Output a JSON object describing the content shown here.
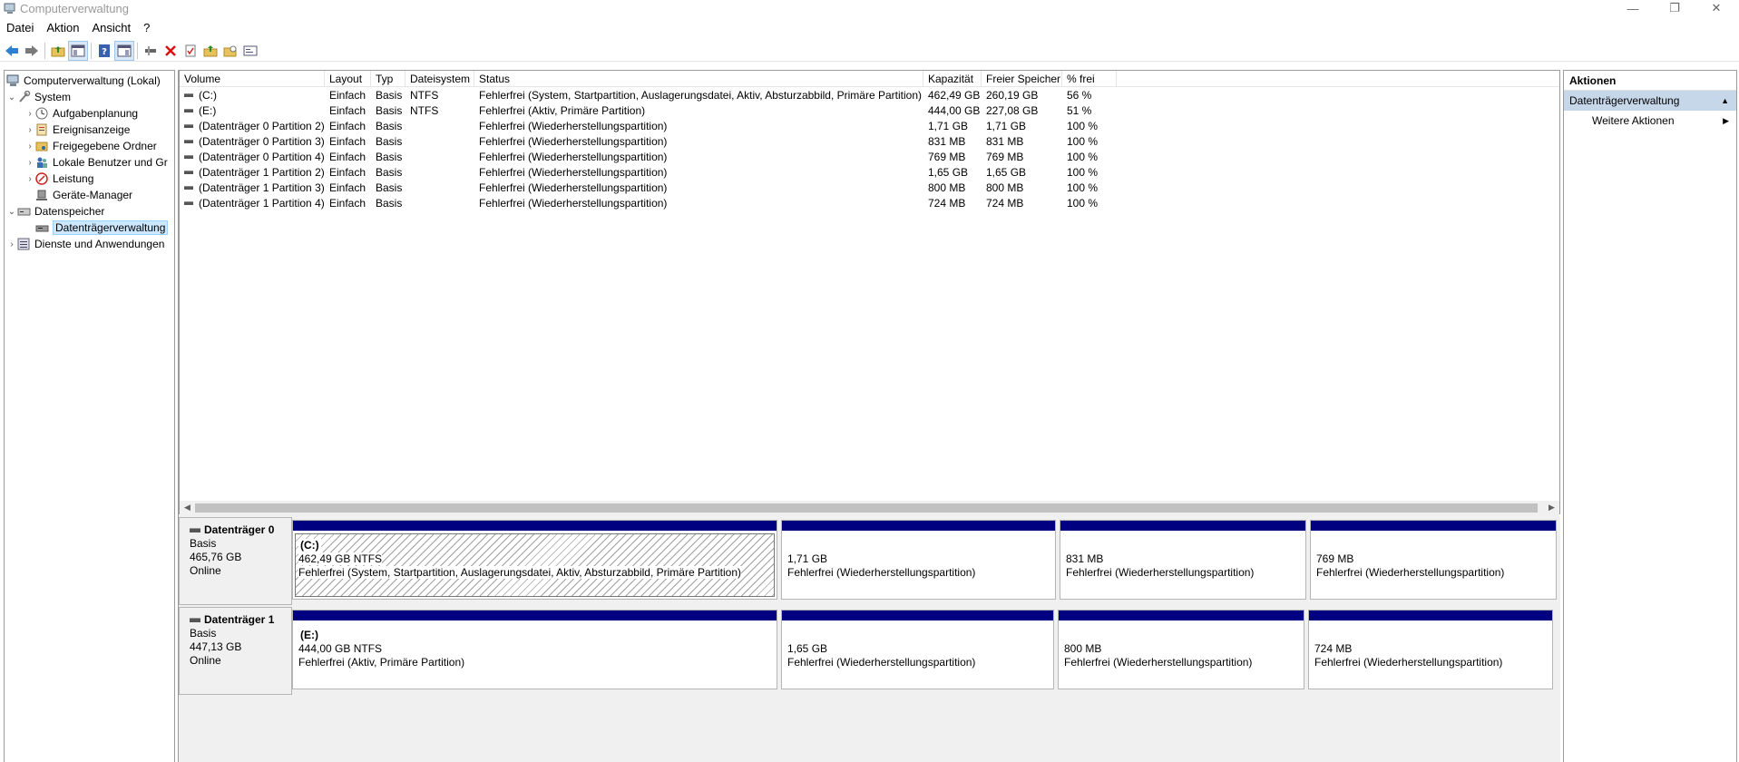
{
  "window": {
    "title": "Computerverwaltung",
    "minimize_glyph": "—",
    "maximize_glyph": "❐",
    "close_glyph": "✕"
  },
  "menu": [
    "Datei",
    "Aktion",
    "Ansicht",
    "?"
  ],
  "toolbar": {
    "icons": [
      "back-icon",
      "forward-icon",
      "up-folder-icon",
      "show-hide-tree-icon",
      "help-icon",
      "properties-view-icon",
      "connect-icon",
      "delete-icon",
      "check-icon",
      "export-icon",
      "open-folder-icon",
      "console-icon"
    ]
  },
  "tree": {
    "root": "Computerverwaltung (Lokal)",
    "system": "System",
    "aufgabenplanung": "Aufgabenplanung",
    "ereignisanzeige": "Ereignisanzeige",
    "freigegebene_ordner": "Freigegebene Ordner",
    "lokale_benutzer": "Lokale Benutzer und Gr",
    "leistung": "Leistung",
    "geraete_manager": "Geräte-Manager",
    "datenspeicher": "Datenspeicher",
    "datentraegerverwaltung": "Datenträgerverwaltung",
    "dienste": "Dienste und Anwendungen"
  },
  "volume_list": {
    "columns": [
      "Volume",
      "Layout",
      "Typ",
      "Dateisystem",
      "Status",
      "Kapazität",
      "Freier Speicher",
      "% frei"
    ],
    "rows": [
      [
        "(C:)",
        "Einfach",
        "Basis",
        "NTFS",
        "Fehlerfrei (System, Startpartition, Auslagerungsdatei, Aktiv, Absturzabbild, Primäre Partition)",
        "462,49 GB",
        "260,19 GB",
        "56 %"
      ],
      [
        "(E:)",
        "Einfach",
        "Basis",
        "NTFS",
        "Fehlerfrei (Aktiv, Primäre Partition)",
        "444,00 GB",
        "227,08 GB",
        "51 %"
      ],
      [
        "(Datenträger 0 Partition 2)",
        "Einfach",
        "Basis",
        "",
        "Fehlerfrei (Wiederherstellungspartition)",
        "1,71 GB",
        "1,71 GB",
        "100 %"
      ],
      [
        "(Datenträger 0 Partition 3)",
        "Einfach",
        "Basis",
        "",
        "Fehlerfrei (Wiederherstellungspartition)",
        "831 MB",
        "831 MB",
        "100 %"
      ],
      [
        "(Datenträger 0 Partition 4)",
        "Einfach",
        "Basis",
        "",
        "Fehlerfrei (Wiederherstellungspartition)",
        "769 MB",
        "769 MB",
        "100 %"
      ],
      [
        "(Datenträger 1 Partition 2)",
        "Einfach",
        "Basis",
        "",
        "Fehlerfrei (Wiederherstellungspartition)",
        "1,65 GB",
        "1,65 GB",
        "100 %"
      ],
      [
        "(Datenträger 1 Partition 3)",
        "Einfach",
        "Basis",
        "",
        "Fehlerfrei (Wiederherstellungspartition)",
        "800 MB",
        "800 MB",
        "100 %"
      ],
      [
        "(Datenträger 1 Partition 4)",
        "Einfach",
        "Basis",
        "",
        "Fehlerfrei (Wiederherstellungspartition)",
        "724 MB",
        "724 MB",
        "100 %"
      ]
    ]
  },
  "disks": [
    {
      "name": "Datenträger 0",
      "type": "Basis",
      "size": "465,76 GB",
      "state": "Online",
      "partitions": [
        {
          "label": "(C:)",
          "size": "462,49 GB NTFS",
          "status": "Fehlerfrei (System, Startpartition, Auslagerungsdatei, Aktiv, Absturzabbild, Primäre Partition)"
        },
        {
          "label": "",
          "size": "1,71 GB",
          "status": "Fehlerfrei (Wiederherstellungspartition)"
        },
        {
          "label": "",
          "size": "831 MB",
          "status": "Fehlerfrei (Wiederherstellungspartition)"
        },
        {
          "label": "",
          "size": "769 MB",
          "status": "Fehlerfrei (Wiederherstellungspartition)"
        }
      ]
    },
    {
      "name": "Datenträger 1",
      "type": "Basis",
      "size": "447,13 GB",
      "state": "Online",
      "partitions": [
        {
          "label": "(E:)",
          "size": "444,00 GB NTFS",
          "status": "Fehlerfrei (Aktiv, Primäre Partition)"
        },
        {
          "label": "",
          "size": "1,65 GB",
          "status": "Fehlerfrei (Wiederherstellungspartition)"
        },
        {
          "label": "",
          "size": "800 MB",
          "status": "Fehlerfrei (Wiederherstellungspartition)"
        },
        {
          "label": "",
          "size": "724 MB",
          "status": "Fehlerfrei (Wiederherstellungspartition)"
        }
      ]
    }
  ],
  "actions": {
    "header": "Aktionen",
    "section": "Datenträgerverwaltung",
    "item": "Weitere Aktionen"
  },
  "colors": {
    "partition_bar": "#000080",
    "selection": "#cce8ff",
    "actions_section": "#c7d7ea"
  }
}
